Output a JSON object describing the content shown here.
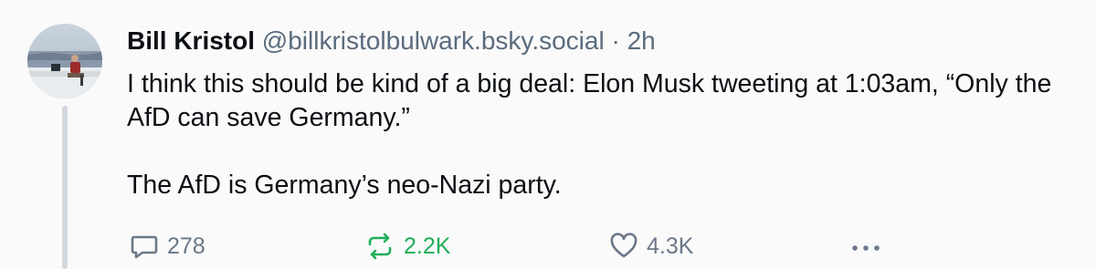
{
  "author": {
    "display_name": "Bill Kristol",
    "handle": "@billkristolbulwark.bsky.social",
    "separator": "·",
    "time_ago": "2h"
  },
  "post": {
    "paragraphs": [
      "I think this should be kind of a big deal: Elon Musk tweeting at 1:03am, “Only the AfD can save Germany.”",
      "The AfD is Germany’s neo-Nazi party."
    ]
  },
  "actions": {
    "reply_count": "278",
    "repost_count": "2.2K",
    "like_count": "4.3K"
  },
  "icons": {
    "reply": "speech-bubble-icon",
    "repost": "repost-arrows-icon",
    "like": "heart-icon",
    "more": "more-dots-icon"
  },
  "colors": {
    "background": "#fafafa",
    "text": "#0b0f14",
    "muted": "#5a6b7d",
    "repost_active": "#1fae5a",
    "thread_line": "#d3d8de"
  }
}
